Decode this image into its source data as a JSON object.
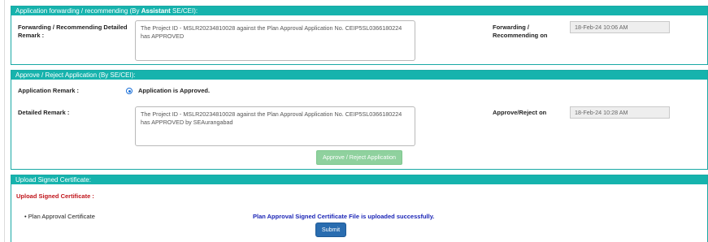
{
  "panel1": {
    "header_prefix": "Application forwarding / recommending (By ",
    "header_bold": "Assistant",
    "header_suffix": " SE/CEI):",
    "remark_label_line1": "Forwarding / Recommending Detailed",
    "remark_label_line2": "Remark :",
    "remark_text": "The Project ID - MSLR20234810028 against the Plan Approval Application No. CEIP5SL0366180224 has APPROVED",
    "date_label_line1": "Forwarding /",
    "date_label_line2": "Recommending on",
    "date_value": "18-Feb-24 10:06 AM"
  },
  "panel2": {
    "header": "Approve / Reject Application (By SE/CEI):",
    "app_remark_label": "Application Remark :",
    "radio_label": "Application is Approved.",
    "detailed_remark_label": "Detailed Remark :",
    "remark_text": "The Project ID - MSLR20234810028 against the Plan Approval Application No. CEIP5SL0366180224 has APPROVED by SEAurangabad",
    "date_label": "Approve/Reject on",
    "date_value": "18-Feb-24 10:28 AM",
    "button_label": "Approve / Reject Application"
  },
  "panel3": {
    "header": "Upload Signed Certificate:",
    "section_label": "Upload Signed Certificate :",
    "bullet_label": "Plan Approval Certificate",
    "success_message": "Plan Approval Signed Certificate File is uploaded successfully.",
    "submit_label": "Submit"
  },
  "colors": {
    "header_bg": "#16b3ad",
    "section_label": "#c0151b",
    "success_text": "#1b25b6",
    "approve_button": "#8fd19e",
    "submit_button": "#2a6db0"
  }
}
